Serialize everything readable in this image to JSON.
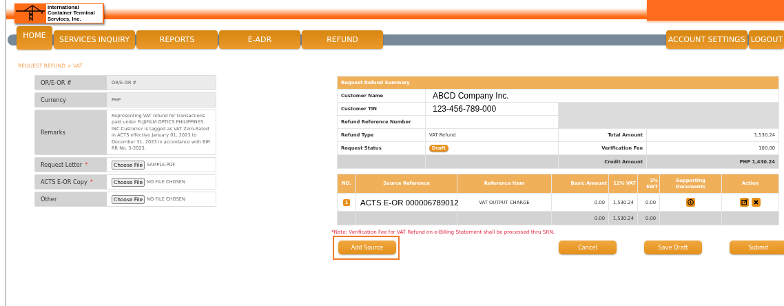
{
  "logo": {
    "company_name": "International\nContainer Terminal\nServices, Inc."
  },
  "nav": {
    "tabs": [
      {
        "label": "HOME",
        "selected": true
      },
      {
        "label": "SERVICES INQUIRY",
        "selected": false
      },
      {
        "label": "REPORTS",
        "selected": false
      },
      {
        "label": "E-ADR",
        "selected": false
      },
      {
        "label": "REFUND",
        "selected": false
      }
    ],
    "right_tabs": [
      {
        "label": "ACCOUNT SETTINGS",
        "selected": false
      },
      {
        "label": "LOGOUT",
        "selected": false
      }
    ]
  },
  "breadcrumb": "REQUEST REFUND > VAT",
  "form": {
    "rows": [
      {
        "label": "OR/E-OR #",
        "kind": "input",
        "placeholder": "OR/E-OR #"
      },
      {
        "label": "Currency",
        "kind": "readonly",
        "value": "PHP"
      },
      {
        "label": "Remarks",
        "kind": "textarea",
        "value": "Representing VAT refund for transactions paid under FUJIFILM OPTICS PHILIPPINES INC.Customer is tagged as VAT Zero-Rated in ACTS effective January 01, 2023 to December 31, 2023 in accordance with BIR RR No. 3-2023."
      },
      {
        "label": "Request Letter",
        "required_mark": "*",
        "kind": "file",
        "button": "Choose File",
        "file_name": "SAMPLE.PDF"
      },
      {
        "label": "ACTS E-OR Copy",
        "required_mark": "*",
        "kind": "file",
        "button": "Choose File",
        "file_name": "NO FILE CHOSEN"
      },
      {
        "label": "Other",
        "kind": "file",
        "button": "Choose File",
        "file_name": "NO FILE CHOSEN"
      }
    ]
  },
  "summary": {
    "title": "Request Refund Summary",
    "customer_name": {
      "label": "Customer Name",
      "value": "ABCD Company Inc."
    },
    "customer_tin": {
      "label": "Customer TIN",
      "value": "123-456-789-000"
    },
    "refund_reference": {
      "label": "Refund Reference Number"
    },
    "refund_type": {
      "label": "Refund Type",
      "value": "VAT Refund"
    },
    "request_status": {
      "label": "Request Status",
      "value": "Draft"
    },
    "total_amount": {
      "label": "Total Amount",
      "value": "1,530.24"
    },
    "verification_fee": {
      "label": "Verification Fee",
      "value": "100.00"
    },
    "credit_amount": {
      "label": "Credit Amount",
      "value": "PHP 1,430.24"
    }
  },
  "items": {
    "columns": [
      "NO.",
      "Source Reference",
      "Reference Item",
      "Basic Amount",
      "12% VAT",
      "2% EWT",
      "Supporting Documents",
      "Action"
    ],
    "rows": [
      {
        "no": "1",
        "source_reference": "ACTS E-OR 000006789012",
        "reference_item": "VAT OUTPUT CHARGE",
        "basic_amount": "0.00",
        "vat": "1,530.24",
        "ewt": "0.00"
      }
    ],
    "totals": {
      "basic_amount": "0.00",
      "vat": "1,530.24",
      "ewt": "0.00"
    }
  },
  "note": "*Note: Verification Fee for VAT Refund on e-Billing Statement shall be processed thru SRN.",
  "buttons": [
    {
      "label": "Add Source",
      "highlighted": true
    },
    {
      "label": "Cancel",
      "highlighted": false
    },
    {
      "label": "Save Draft",
      "highlighted": false
    },
    {
      "label": "Submit",
      "highlighted": false
    }
  ]
}
